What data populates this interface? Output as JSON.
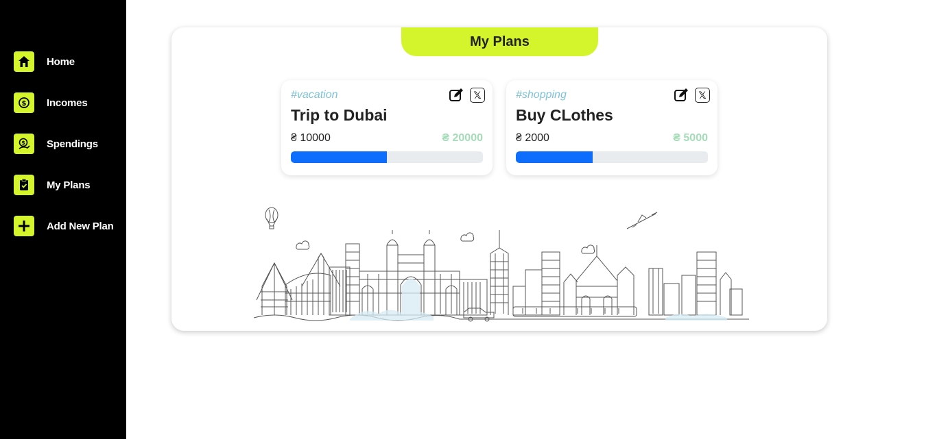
{
  "sidebar": {
    "items": [
      {
        "label": "Home",
        "icon": "home-icon"
      },
      {
        "label": "Incomes",
        "icon": "coin-icon"
      },
      {
        "label": "Spendings",
        "icon": "spending-icon"
      },
      {
        "label": "My Plans",
        "icon": "clipboard-check-icon"
      },
      {
        "label": "Add New Plan",
        "icon": "plus-icon"
      }
    ],
    "accent": "#d4f52b"
  },
  "panel": {
    "title": "My Plans"
  },
  "plans": [
    {
      "tag": "#vacation",
      "title": "Trip to Dubai",
      "current": "₴ 10000",
      "target": "₴ 20000",
      "progress": 0.5
    },
    {
      "tag": "#shopping",
      "title": "Buy CLothes",
      "current": "₴ 2000",
      "target": "₴ 5000",
      "progress": 0.4
    }
  ],
  "colors": {
    "progress": "#0d6efd",
    "tag": "#7cc3d8",
    "target": "#a3dcb6"
  }
}
